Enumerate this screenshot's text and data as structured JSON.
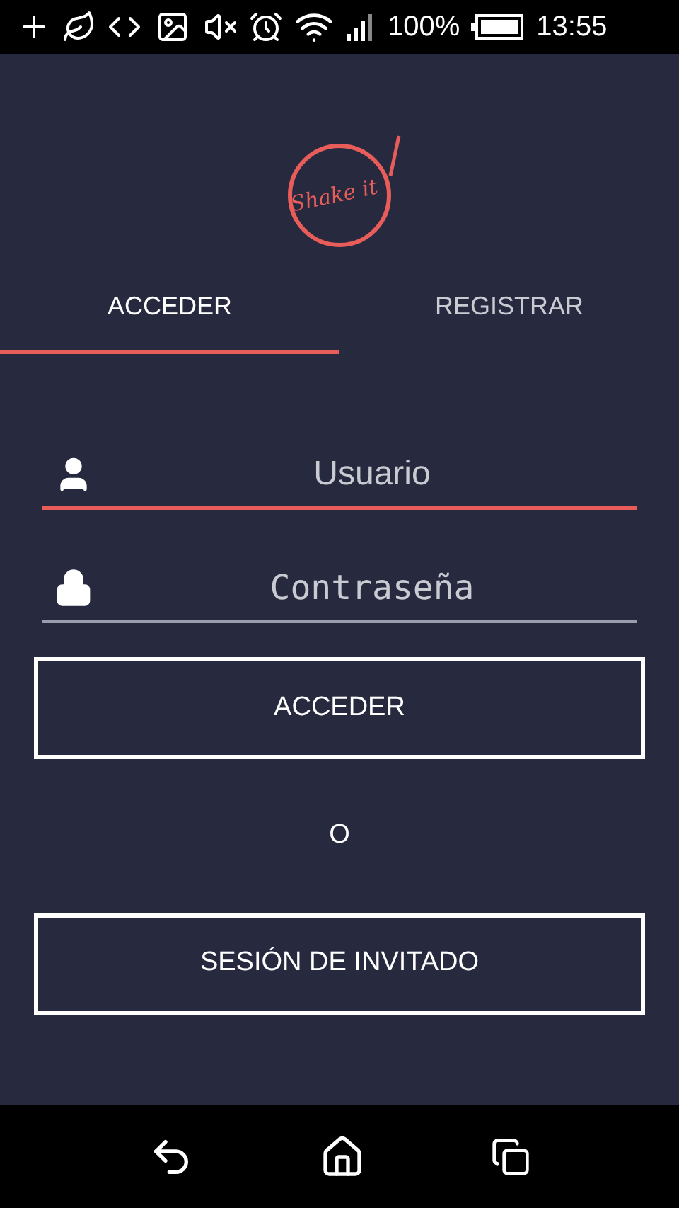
{
  "status_bar": {
    "battery": "100%",
    "time": "13:55"
  },
  "logo": {
    "text": "Shake it"
  },
  "tabs": [
    {
      "label": "ACCEDER",
      "selected": true
    },
    {
      "label": "REGISTRAR",
      "selected": false
    }
  ],
  "fields": [
    {
      "kind": "user",
      "placeholder": "Usuario",
      "focused": true
    },
    {
      "kind": "password",
      "placeholder": "Contraseña",
      "focused": false
    }
  ],
  "login_button": "ACCEDER",
  "separator": "O",
  "guest_button": "SESIÓN DE INVITADO"
}
